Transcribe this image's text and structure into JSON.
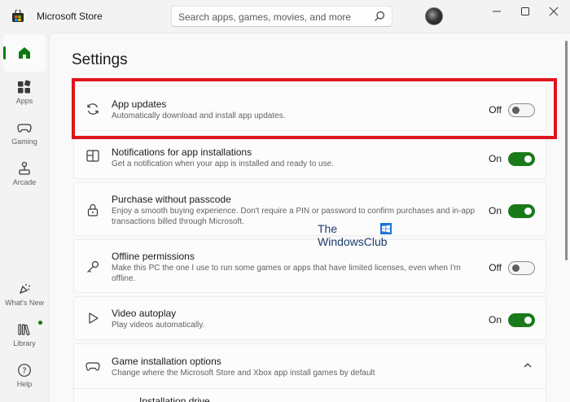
{
  "window": {
    "title": "Microsoft Store",
    "search_placeholder": "Search apps, games, movies, and more"
  },
  "nav": {
    "items": [
      {
        "label": "",
        "icon": "home-icon",
        "active": true
      },
      {
        "label": "Apps",
        "icon": "apps-icon"
      },
      {
        "label": "Gaming",
        "icon": "gaming-icon"
      },
      {
        "label": "Arcade",
        "icon": "arcade-icon"
      },
      {
        "label": "What's New",
        "icon": "whats-new-icon"
      },
      {
        "label": "Library",
        "icon": "library-icon"
      },
      {
        "label": "Help",
        "icon": "help-icon"
      }
    ]
  },
  "page": {
    "title": "Settings"
  },
  "settings": [
    {
      "title": "App updates",
      "desc": "Automatically download and install app updates.",
      "state_label": "Off",
      "on": false,
      "icon": "sync-icon"
    },
    {
      "title": "Notifications for app installations",
      "desc": "Get a notification when your app is installed and ready to use.",
      "state_label": "On",
      "on": true,
      "icon": "notification-icon"
    },
    {
      "title": "Purchase without passcode",
      "desc": "Enjoy a smooth buying experience. Don't require a PIN or password to confirm purchases and in-app transactions billed through Microsoft.",
      "state_label": "On",
      "on": true,
      "icon": "lock-icon"
    },
    {
      "title": "Offline permissions",
      "desc": "Make this PC the one I use to run some games or apps that have limited licenses, even when I'm offline.",
      "state_label": "Off",
      "on": false,
      "icon": "key-icon"
    },
    {
      "title": "Video autoplay",
      "desc": "Play videos automatically.",
      "state_label": "On",
      "on": true,
      "icon": "play-icon"
    },
    {
      "title": "Game installation options",
      "desc": "Change where the Microsoft Store and Xbox app install games by default",
      "icon": "controller-icon",
      "expanded": true
    },
    {
      "title": "Installation drive"
    }
  ],
  "watermark": {
    "line1": "The",
    "line2": "WindowsClub"
  },
  "colors": {
    "accent": "#0f7b0f",
    "highlight": "#e0141b"
  }
}
